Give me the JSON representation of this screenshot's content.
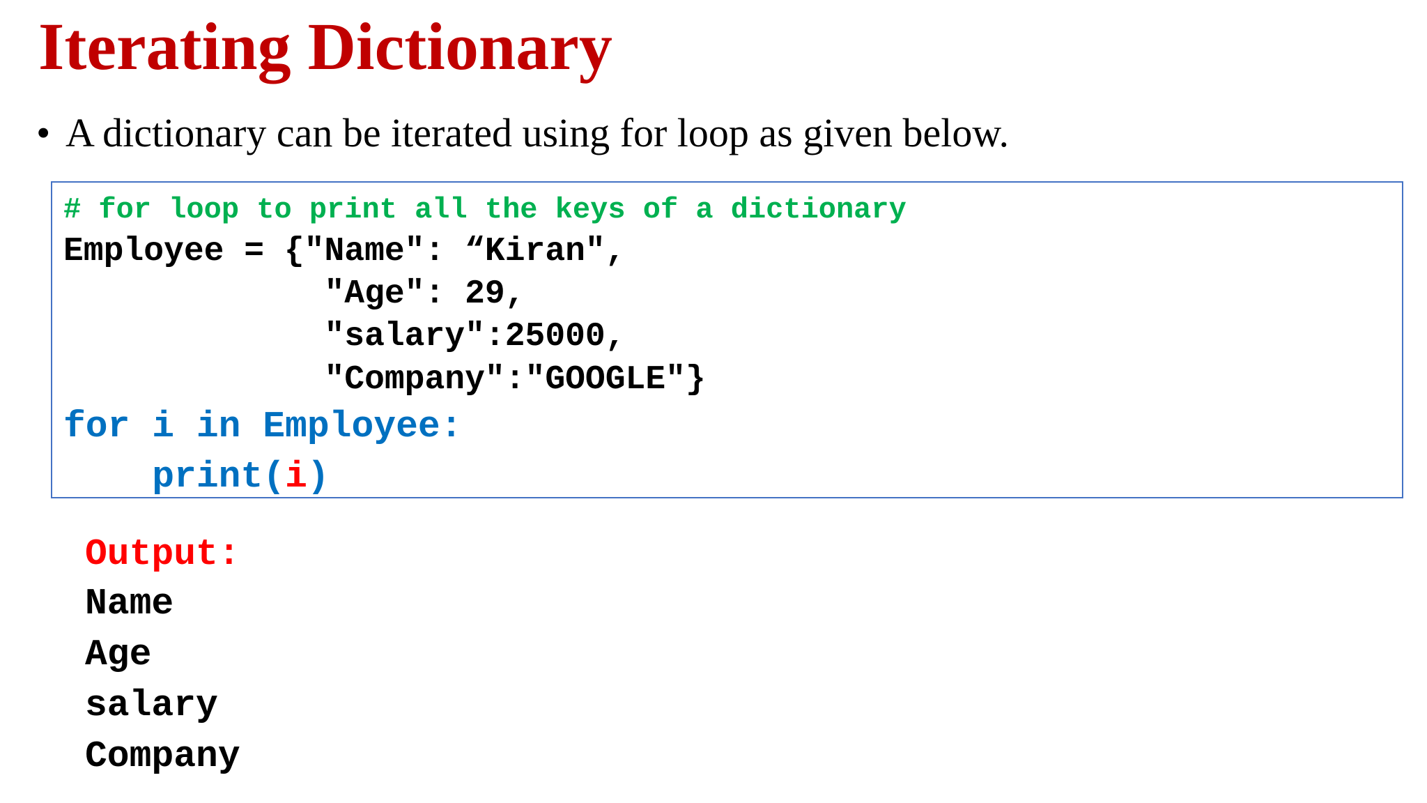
{
  "slide": {
    "title": "Iterating Dictionary",
    "bullet_symbol": "•",
    "bullet_text": "A dictionary can be iterated using for loop as given below."
  },
  "code": {
    "comment": "# for loop to print all the keys of a dictionary",
    "dict_lines": [
      "Employee = {\"Name\": “Kiran\",",
      "             \"Age\": 29,",
      "             \"salary\":25000,",
      "             \"Company\":\"GOOGLE\"}"
    ],
    "for_line": "for i in Employee:",
    "print_indent": "    ",
    "print_fn": "print(",
    "print_var": "i",
    "print_close": ")"
  },
  "output": {
    "label": "Output:",
    "lines": [
      "Name",
      "Age",
      "salary",
      "Company"
    ]
  },
  "colors": {
    "title": "#C00000",
    "comment": "#00B050",
    "keyword": "#0070C0",
    "highlight": "#FF0000",
    "box_border": "#4472C4"
  }
}
